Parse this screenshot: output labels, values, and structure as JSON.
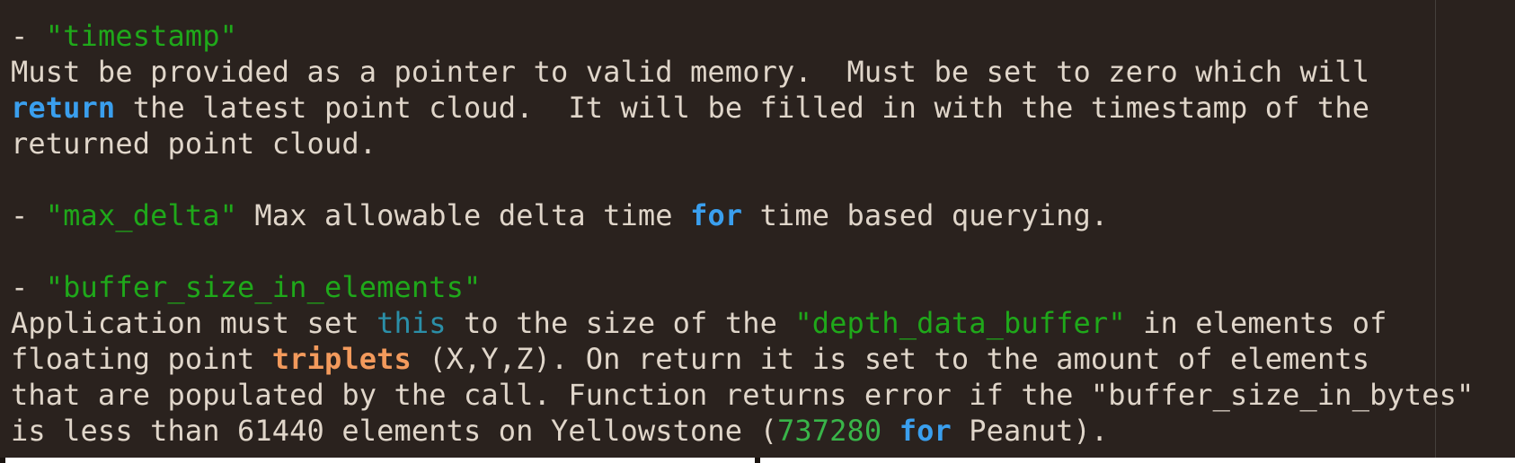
{
  "colors": {
    "background": "#2a221e",
    "text": "#e0d6ca",
    "string": "#1fa81a",
    "keyword": "#3a9fee",
    "self_keyword": "#2b8fa8",
    "type": "#f39a5c",
    "number": "#39b549"
  },
  "lines": [
    [
      {
        "t": "- ",
        "k": "plain"
      },
      {
        "t": "\"timestamp\"",
        "k": "string"
      }
    ],
    [
      {
        "t": "Must be provided as a pointer to valid memory.  Must be set to zero which will",
        "k": "plain"
      }
    ],
    [
      {
        "t": "return",
        "k": "keyword"
      },
      {
        "t": " the latest point cloud.  It will be filled in with the timestamp of the",
        "k": "plain"
      }
    ],
    [
      {
        "t": "returned point cloud.",
        "k": "plain"
      }
    ],
    [],
    [
      {
        "t": "- ",
        "k": "plain"
      },
      {
        "t": "\"max_delta\"",
        "k": "string"
      },
      {
        "t": " Max allowable delta time ",
        "k": "plain"
      },
      {
        "t": "for",
        "k": "keyword"
      },
      {
        "t": " time based querying.",
        "k": "plain"
      }
    ],
    [],
    [
      {
        "t": "- ",
        "k": "plain"
      },
      {
        "t": "\"buffer_size_in_elements\"",
        "k": "string"
      }
    ],
    [
      {
        "t": "Application must set ",
        "k": "plain"
      },
      {
        "t": "this",
        "k": "self"
      },
      {
        "t": " to the size of the ",
        "k": "plain"
      },
      {
        "t": "\"depth_data_buffer\"",
        "k": "string"
      },
      {
        "t": " in elements of",
        "k": "plain"
      }
    ],
    [
      {
        "t": "floating point ",
        "k": "plain"
      },
      {
        "t": "triplets",
        "k": "type"
      },
      {
        "t": " (X,Y,Z). On return it is set to the amount of elements",
        "k": "plain"
      }
    ],
    [
      {
        "t": "that are populated by the call. Function returns error if the \"buffer_size_in_bytes\"",
        "k": "plain"
      }
    ],
    [
      {
        "t": "is less than 61440 elements on Yellowstone (",
        "k": "plain"
      },
      {
        "t": "737280",
        "k": "number"
      },
      {
        "t": " ",
        "k": "plain"
      },
      {
        "t": "for",
        "k": "keyword"
      },
      {
        "t": " Peanut).",
        "k": "plain"
      }
    ]
  ]
}
